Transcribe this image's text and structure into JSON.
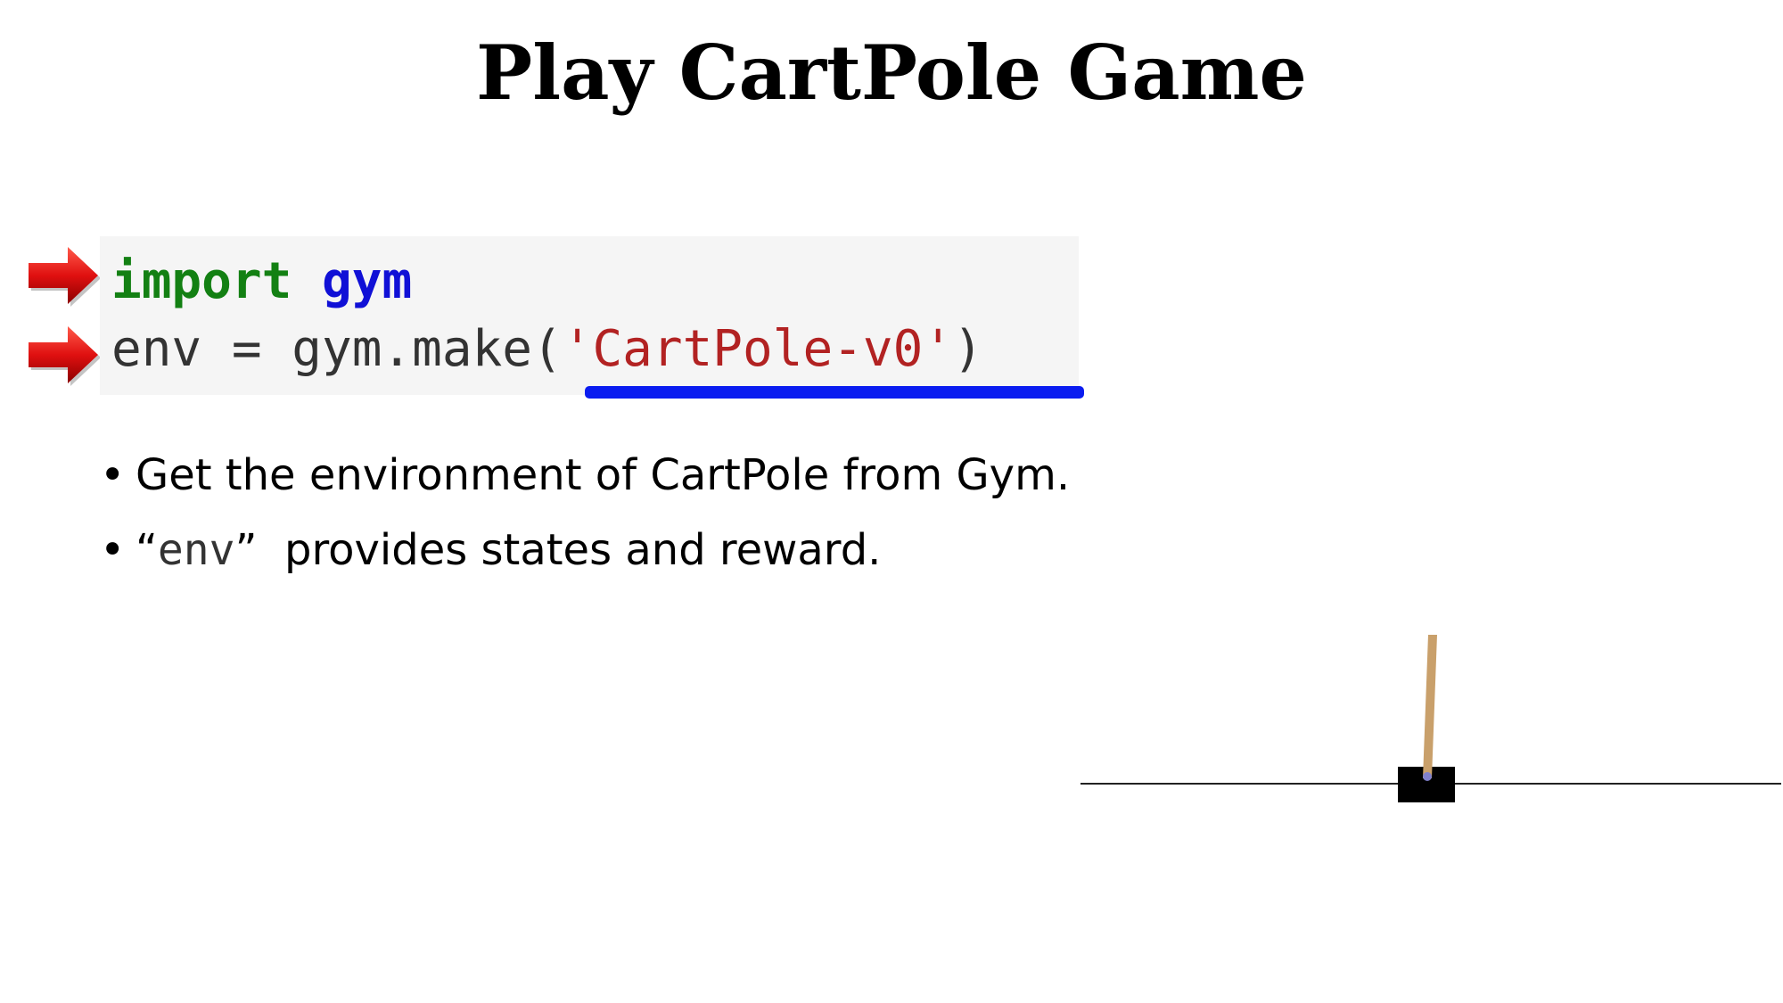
{
  "slide": {
    "title": "Play CartPole Game"
  },
  "code": {
    "line1": {
      "keyword": "import",
      "module": "gym"
    },
    "line2": {
      "prefix": "env = gym.make(",
      "string": "'CartPole-v0'",
      "suffix": ")"
    },
    "highlight_color": "#0a1cf0",
    "arrow_icon": "red-arrow-icon"
  },
  "bullets": {
    "item1": "Get the environment of CartPole from Gym.",
    "item2_quote_open": "“",
    "item2_code": "env",
    "item2_quote_close": "”",
    "item2_rest": "provides states and reward."
  },
  "illustration": {
    "name": "cartpole-render",
    "cart_color": "#000000",
    "pole_color": "#c9a06b",
    "axle_color": "#8080cc"
  }
}
